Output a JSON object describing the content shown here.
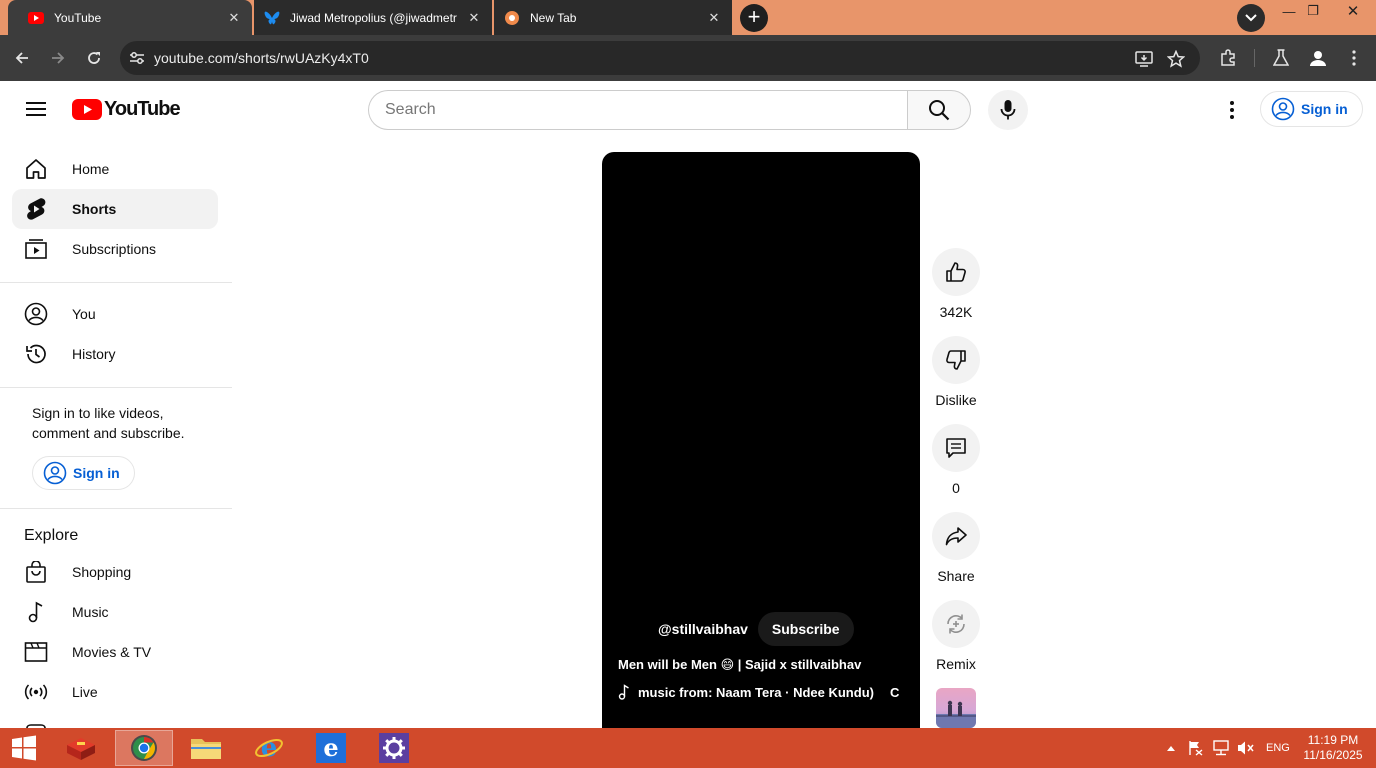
{
  "browser": {
    "tabs": [
      {
        "title": "YouTube",
        "icon": "youtube-favicon",
        "active": true
      },
      {
        "title": "Jiwad Metropolius (@jiwadmetr",
        "icon": "bluesky-favicon",
        "active": false
      },
      {
        "title": "New Tab",
        "icon": "newtab-favicon",
        "active": false
      }
    ],
    "url": "youtube.com/shorts/rwUAzKy4xT0"
  },
  "header": {
    "logo_text": "YouTube",
    "search_placeholder": "Search",
    "sign_in": "Sign in"
  },
  "sidebar": {
    "items": [
      {
        "label": "Home",
        "icon": "home-icon"
      },
      {
        "label": "Shorts",
        "icon": "shorts-icon"
      },
      {
        "label": "Subscriptions",
        "icon": "subscriptions-icon"
      },
      {
        "label": "You",
        "icon": "you-icon"
      },
      {
        "label": "History",
        "icon": "history-icon"
      }
    ],
    "signin_prompt": "Sign in to like videos, comment and subscribe.",
    "signin_button": "Sign in",
    "explore_heading": "Explore",
    "explore_items": [
      {
        "label": "Shopping",
        "icon": "shopping-icon"
      },
      {
        "label": "Music",
        "icon": "music-icon"
      },
      {
        "label": "Movies & TV",
        "icon": "movies-icon"
      },
      {
        "label": "Live",
        "icon": "live-icon"
      }
    ]
  },
  "short": {
    "channel": "@stillvaibhav",
    "subscribe": "Subscribe",
    "title": "Men will be Men 😄 | Sajid x stillvaibhav",
    "music": "music from: Naam Tera · Ndee Kundu)",
    "music_overflow": "C"
  },
  "actions": {
    "likes": "342K",
    "dislike": "Dislike",
    "comments": "0",
    "share": "Share",
    "remix": "Remix"
  },
  "taskbar": {
    "language": "ENG",
    "time": "11:19 PM",
    "date": "11/16/2025"
  },
  "colors": {
    "tab_strip": "#e8956a",
    "browser_toolbar": "#3c3c3c",
    "youtube_red": "#ff0000",
    "link_blue": "#065fd4",
    "taskbar": "#d14a2b"
  }
}
